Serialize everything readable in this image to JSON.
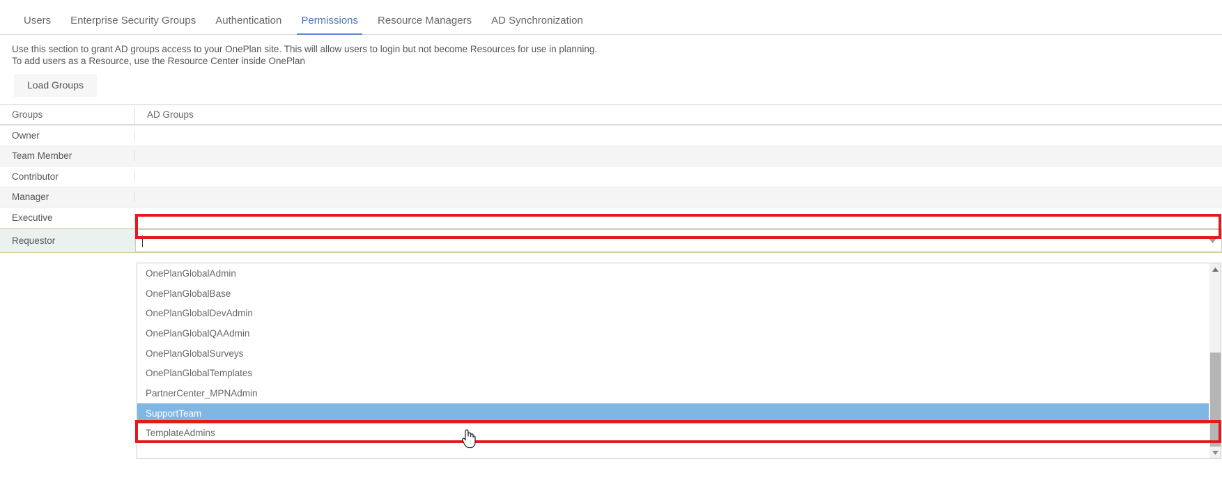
{
  "tabs": [
    {
      "label": "Users",
      "active": false
    },
    {
      "label": "Enterprise Security Groups",
      "active": false
    },
    {
      "label": "Authentication",
      "active": false
    },
    {
      "label": "Permissions",
      "active": true
    },
    {
      "label": "Resource Managers",
      "active": false
    },
    {
      "label": "AD Synchronization",
      "active": false
    }
  ],
  "description": {
    "line1": "Use this section to grant AD groups access to your OnePlan site. This will allow users to login but not become Resources for use in planning.",
    "line2": "To add users as a Resource, use the Resource Center inside OnePlan"
  },
  "toolbar": {
    "load_groups_label": "Load Groups"
  },
  "grid": {
    "columns": [
      "Groups",
      "AD Groups"
    ],
    "rows": [
      {
        "group": "Owner",
        "ad_groups": ""
      },
      {
        "group": "Team Member",
        "ad_groups": ""
      },
      {
        "group": "Contributor",
        "ad_groups": ""
      },
      {
        "group": "Manager",
        "ad_groups": ""
      },
      {
        "group": "Executive",
        "ad_groups": ""
      },
      {
        "group": "Requestor",
        "ad_groups": ""
      }
    ]
  },
  "combobox": {
    "value": "",
    "placeholder": "",
    "arrow_icon": "chevron-down-icon"
  },
  "dropdown": {
    "items": [
      {
        "label": "OnePlanGlobalAdmin",
        "selected": false
      },
      {
        "label": "OnePlanGlobalBase",
        "selected": false
      },
      {
        "label": "OnePlanGlobalDevAdmin",
        "selected": false
      },
      {
        "label": "OnePlanGlobalQAAdmin",
        "selected": false
      },
      {
        "label": "OnePlanGlobalSurveys",
        "selected": false
      },
      {
        "label": "OnePlanGlobalTemplates",
        "selected": false
      },
      {
        "label": "PartnerCenter_MPNAdmin",
        "selected": false
      },
      {
        "label": "SupportTeam",
        "selected": true
      },
      {
        "label": "TemplateAdmins",
        "selected": false
      }
    ],
    "scrollbar": {
      "up_arrow_icon": "caret-up-icon",
      "down_arrow_icon": "caret-down-icon"
    }
  },
  "colors": {
    "accent": "#5b87cf",
    "selection": "#7eb6e4",
    "annotation": "#e41b1b",
    "editing_row": "#e9f1f1",
    "alt_row": "#f5f5f5"
  },
  "cursor": {
    "type": "pointer-hand-cursor"
  }
}
